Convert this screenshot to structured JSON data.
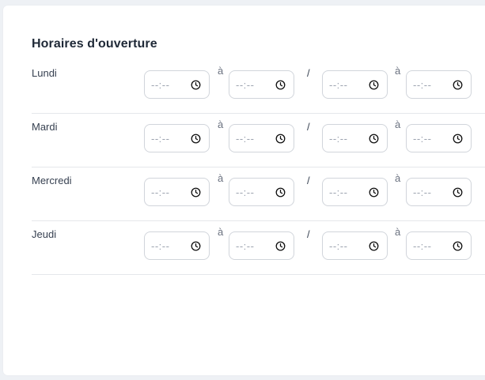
{
  "section": {
    "title": "Horaires d'ouverture"
  },
  "separators": {
    "to": "à",
    "between": "/"
  },
  "placeholder_time": "--:--",
  "days": [
    {
      "label": "Lundi",
      "slots": [
        "--:--",
        "--:--",
        "--:--",
        "--:--"
      ]
    },
    {
      "label": "Mardi",
      "slots": [
        "--:--",
        "--:--",
        "--:--",
        "--:--"
      ]
    },
    {
      "label": "Mercredi",
      "slots": [
        "--:--",
        "--:--",
        "--:--",
        "--:--"
      ]
    },
    {
      "label": "Jeudi",
      "slots": [
        "--:--",
        "--:--",
        "--:--",
        "--:--"
      ]
    }
  ],
  "icons": {
    "time_picker": "clock-icon"
  },
  "colors": {
    "background": "#eef1f5",
    "card": "#ffffff",
    "border": "#d1d5db"
  }
}
